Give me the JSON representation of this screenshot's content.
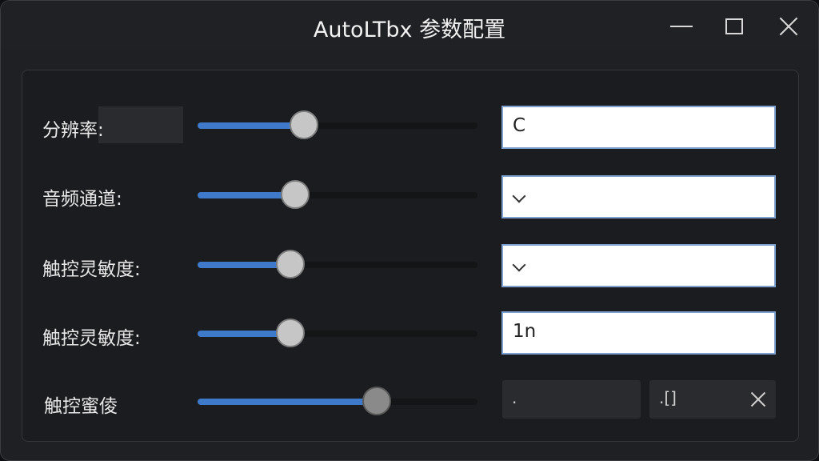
{
  "window": {
    "title": "AutoLTbx 参数配置",
    "controls": {
      "minimize": "minimize-icon",
      "maximize": "maximize-icon",
      "close": "close-icon"
    }
  },
  "rows": [
    {
      "label": "分辨率:",
      "slider_value": 0.38,
      "field_value": "C"
    },
    {
      "label": "音频通道:",
      "slider_value": 0.35,
      "field_value": ""
    },
    {
      "label": "触控灵敏度:",
      "slider_value": 0.33,
      "field_value": ""
    },
    {
      "label": "触控灵敏度:",
      "slider_value": 0.33,
      "field_value": "1n"
    },
    {
      "label": "触控蜜倰",
      "slider_value": 0.64,
      "field_left_value": ".",
      "field_right_value": ".[]"
    }
  ],
  "colors": {
    "accent": "#3f79c9",
    "window_bg": "#1f2023",
    "field_border": "#7ea1cf"
  }
}
